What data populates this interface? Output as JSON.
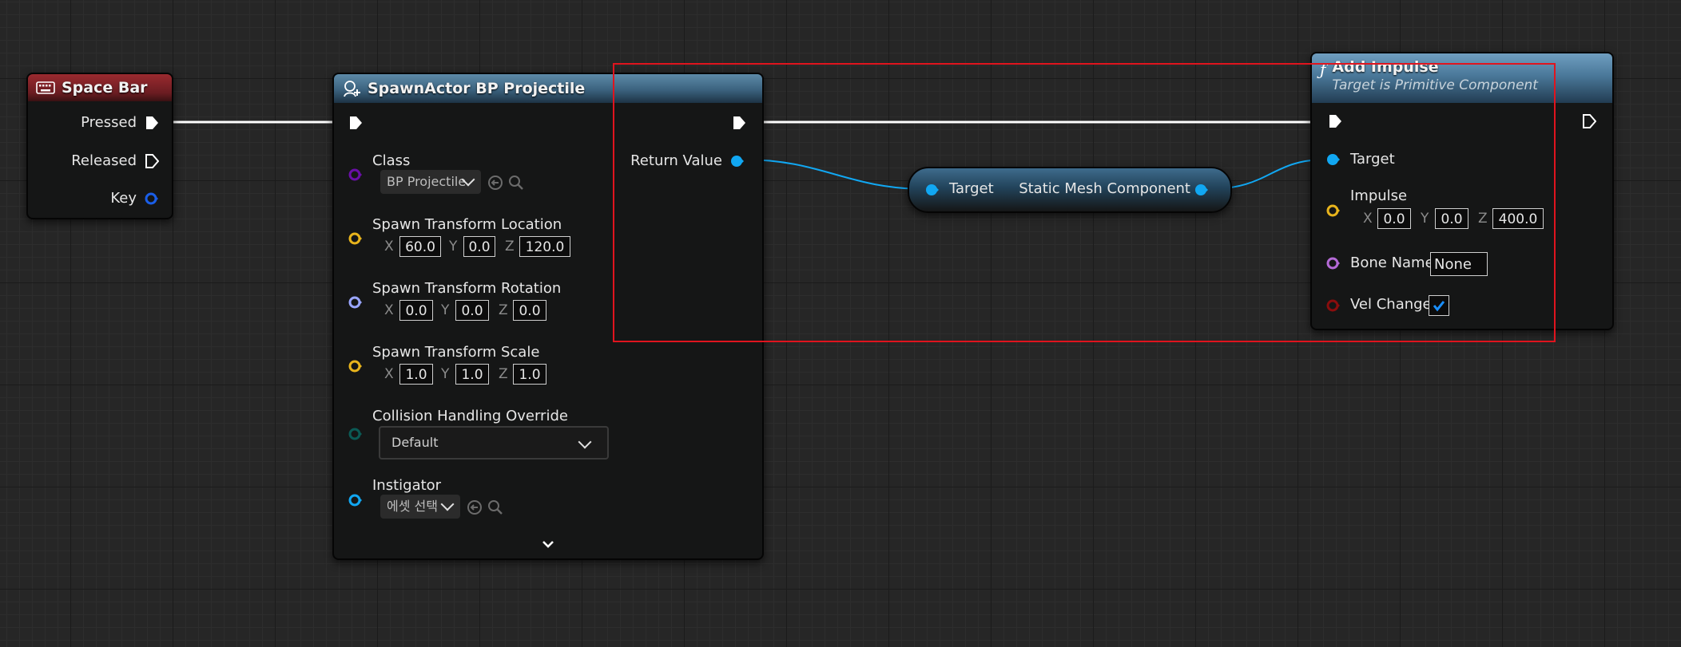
{
  "colors": {
    "exec": "#ffffff",
    "object": "#11a7f2",
    "class": "#6a0fa8",
    "vector": "#e8b41c",
    "rotator": "#9aa6ff",
    "enum": "#0b5a55",
    "name": "#b46ad6",
    "bool": "#8a0d0d",
    "key": "#1a5ee8",
    "selection_box": "#e0141e",
    "check_mark": "#1a8fff"
  },
  "space_bar_node": {
    "icon": "keyboard-icon",
    "title": "Space Bar",
    "pins": {
      "pressed": "Pressed",
      "released": "Released",
      "key": "Key"
    }
  },
  "spawn_node": {
    "icon": "spawn-actor-icon",
    "title": "SpawnActor BP Projectile",
    "class_label": "Class",
    "class_value": "BP Projectile",
    "location_label": "Spawn Transform Location",
    "location": {
      "x_label": "X",
      "x": "60.0",
      "y_label": "Y",
      "y": "0.0",
      "z_label": "Z",
      "z": "120.0"
    },
    "rotation_label": "Spawn Transform Rotation",
    "rotation": {
      "x_label": "X",
      "x": "0.0",
      "y_label": "Y",
      "y": "0.0",
      "z_label": "Z",
      "z": "0.0"
    },
    "scale_label": "Spawn Transform Scale",
    "scale": {
      "x_label": "X",
      "x": "1.0",
      "y_label": "Y",
      "y": "1.0",
      "z_label": "Z",
      "z": "1.0"
    },
    "collision_label": "Collision Handling Override",
    "collision_value": "Default",
    "instigator_label": "Instigator",
    "instigator_value": "에셋 선택",
    "return_label": "Return Value"
  },
  "getter_node": {
    "target_label": "Target",
    "output_label": "Static Mesh Component"
  },
  "impulse_node": {
    "icon": "function-icon",
    "icon_glyph": "ƒ",
    "title": "Add Impulse",
    "subtitle": "Target is Primitive Component",
    "target_label": "Target",
    "impulse_label": "Impulse",
    "impulse": {
      "x_label": "X",
      "x": "0.0",
      "y_label": "Y",
      "y": "0.0",
      "z_label": "Z",
      "z": "400.0"
    },
    "bone_label": "Bone Name",
    "bone_value": "None",
    "vel_label": "Vel Change",
    "vel_change": true
  }
}
